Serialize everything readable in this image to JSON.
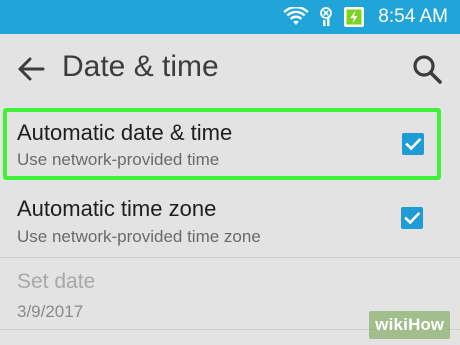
{
  "status_bar": {
    "time": "8:54 AM",
    "icons": [
      "wifi-icon",
      "no-sim-icon",
      "battery-charging-icon"
    ],
    "color": "#21a5d9"
  },
  "toolbar": {
    "title": "Date & time",
    "back_icon": "arrow-left-icon",
    "search_icon": "search-icon"
  },
  "settings": [
    {
      "title": "Automatic date & time",
      "subtitle": "Use network-provided time",
      "checked": true,
      "highlighted": true
    },
    {
      "title": "Automatic time zone",
      "subtitle": "Use network-provided time zone",
      "checked": true,
      "highlighted": false
    },
    {
      "title": "Set date",
      "subtitle": "3/9/2017",
      "enabled": false
    }
  ],
  "colors": {
    "accent": "#1f9cd6",
    "highlight_border": "#3ef23a",
    "background": "#e3e3e3"
  },
  "watermark": {
    "text": "wiki",
    "text_bold": "How"
  }
}
